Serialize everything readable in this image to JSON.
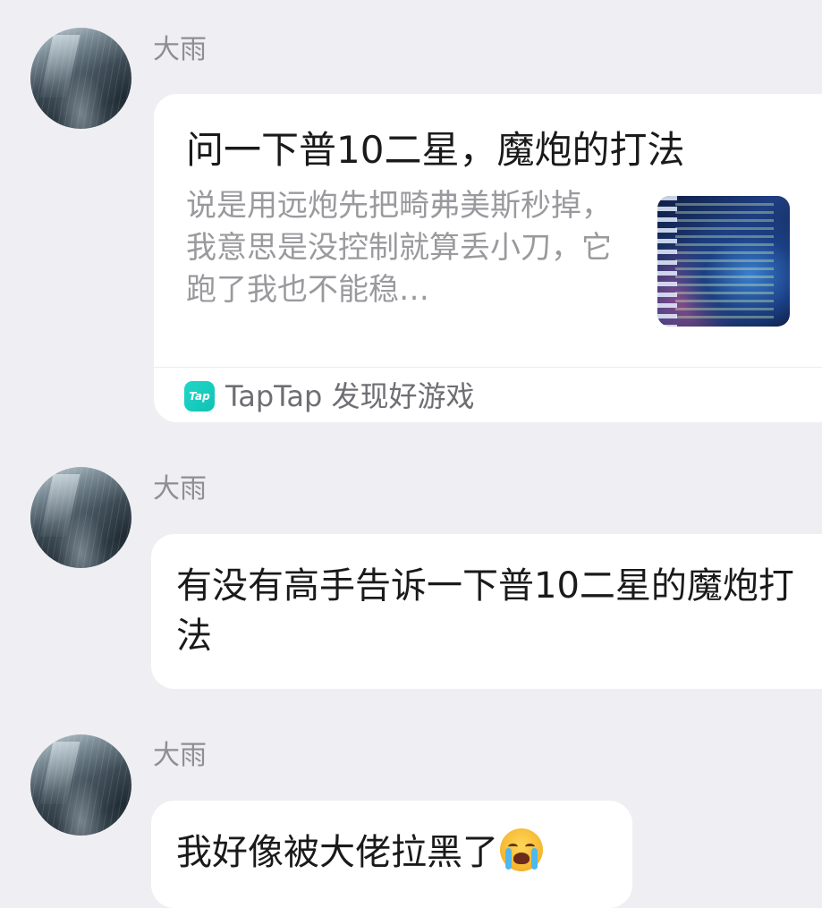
{
  "messages": [
    {
      "sender": "大雨",
      "type": "link_card",
      "card": {
        "title": "问一下普10二星，魔炮的打法",
        "description": "说是用远炮先把畸弗美斯秒掉，我意思是没控制就算丢小刀，它跑了我也不能稳…",
        "thumbnail": "game-screenshot",
        "source_icon": "taptap-logo-icon",
        "source_icon_text": "Tap",
        "source_label": "TapTap 发现好游戏"
      }
    },
    {
      "sender": "大雨",
      "type": "text",
      "text": "有没有高手告诉一下普10二星的魔炮打法"
    },
    {
      "sender": "大雨",
      "type": "text",
      "text": "我好像被大佬拉黑了",
      "emoji": "loudly-crying-face-icon"
    }
  ]
}
